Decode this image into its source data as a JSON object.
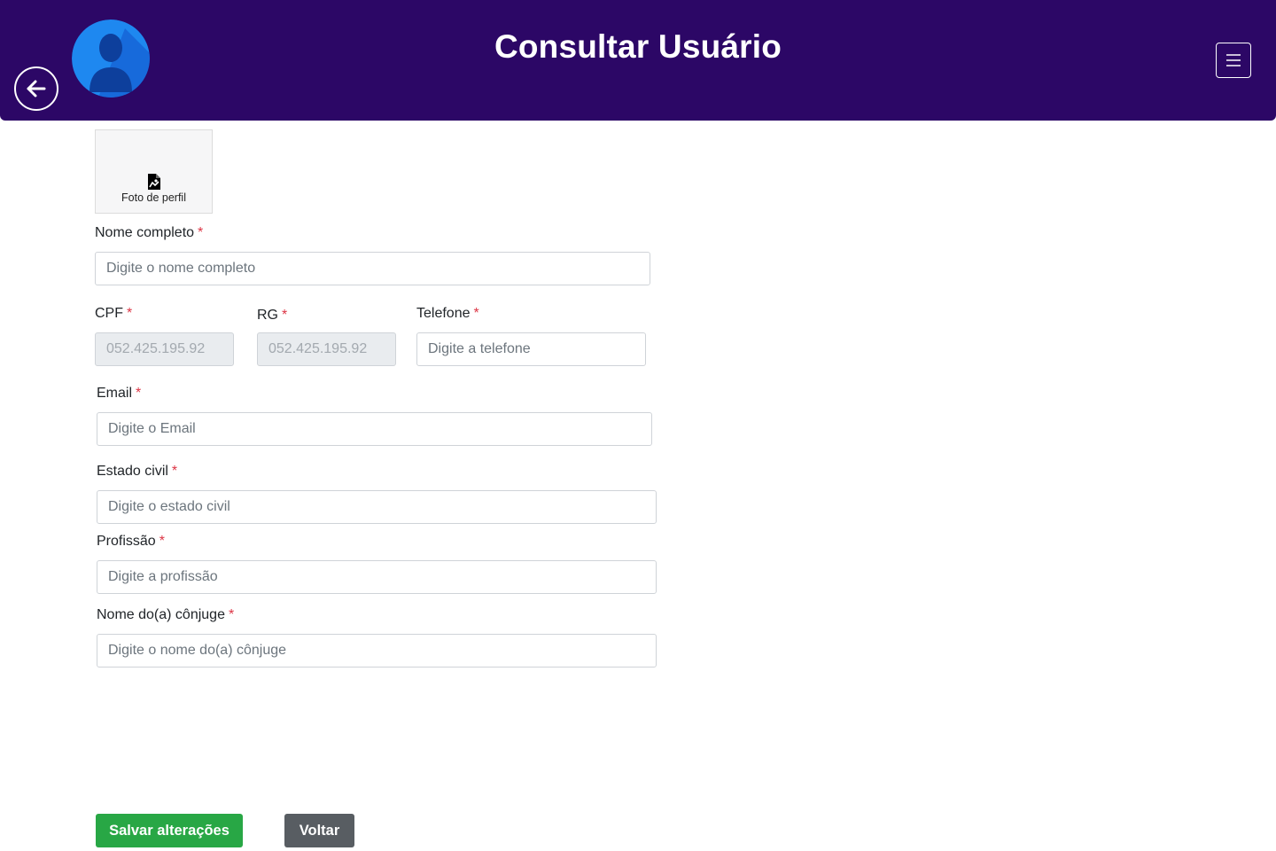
{
  "header": {
    "title": "Consultar Usuário",
    "back_icon": "arrow-left-circle-icon",
    "avatar_icon": "user-avatar-icon",
    "menu_icon": "hamburger-menu-icon"
  },
  "photo": {
    "label": "Foto de perfil",
    "icon": "image-file-icon"
  },
  "form": {
    "required_mark": "*",
    "nome_completo": {
      "label": "Nome completo",
      "placeholder": "Digite o nome completo"
    },
    "cpf": {
      "label": "CPF",
      "value": "052.425.195.92"
    },
    "rg": {
      "label": "RG",
      "value": "052.425.195.92"
    },
    "telefone": {
      "label": "Telefone",
      "placeholder": "Digite a telefone"
    },
    "email": {
      "label": "Email",
      "placeholder": "Digite o Email"
    },
    "estado_civil": {
      "label": "Estado civil",
      "placeholder": "Digite o estado civil"
    },
    "profissao": {
      "label": "Profissão",
      "placeholder": "Digite a profissão"
    },
    "conjuge": {
      "label": "Nome do(a) cônjuge",
      "placeholder": "Digite o nome do(a) cônjuge"
    }
  },
  "actions": {
    "save_label": "Salvar alterações",
    "back_label": "Voltar"
  },
  "colors": {
    "header_bg": "#2c0766",
    "save_button": "#28a745",
    "back_button": "#585d62",
    "required": "#dc3545"
  }
}
